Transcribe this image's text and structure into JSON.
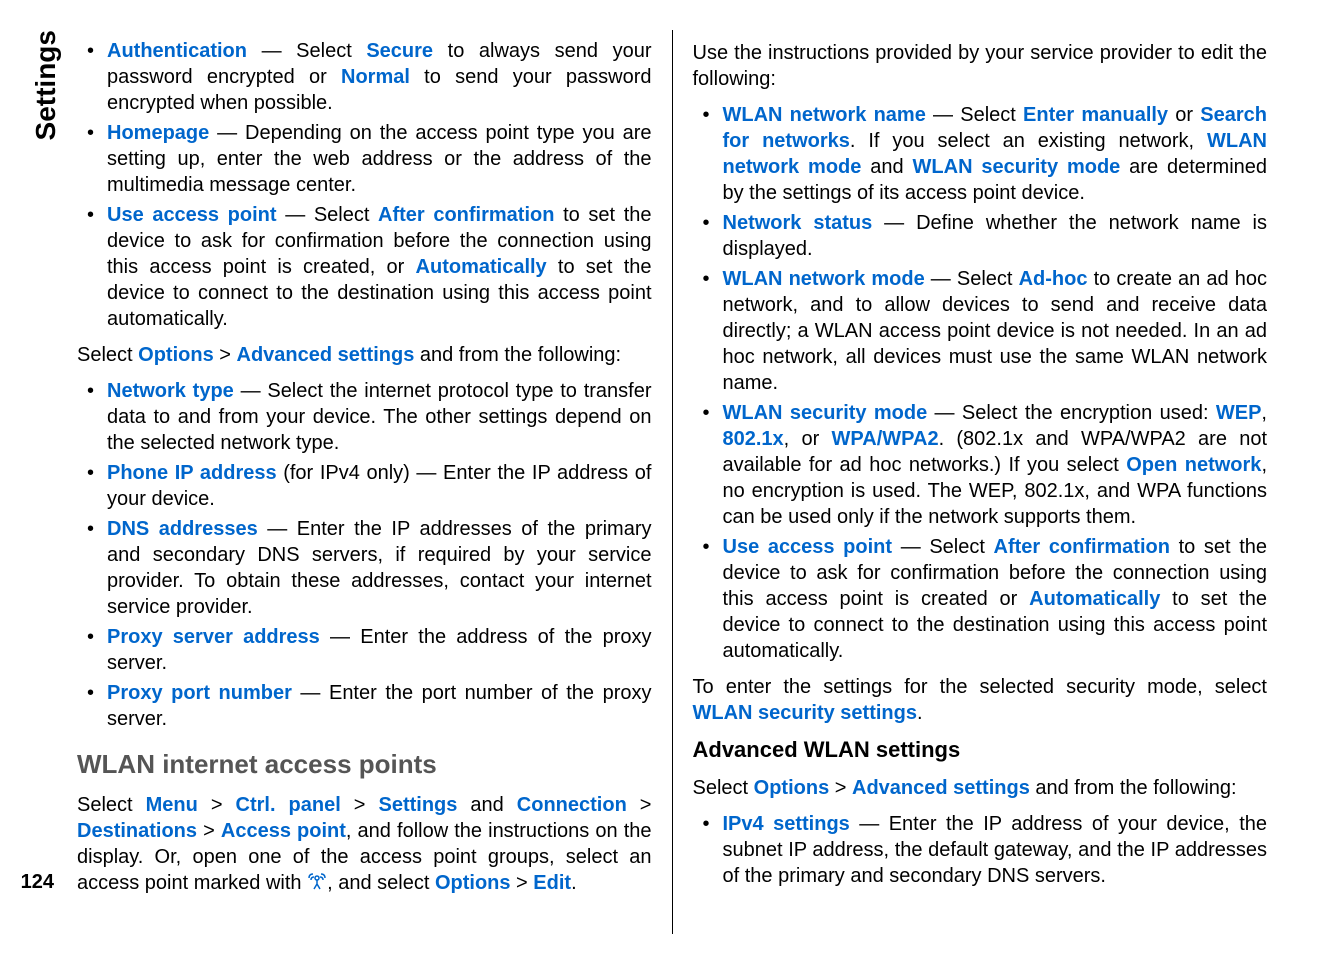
{
  "sidebar": {
    "label": "Settings"
  },
  "page_number": "124",
  "left": {
    "bullets1": [
      {
        "term": "Authentication",
        "pre": " — Select ",
        "opt1": "Secure",
        "mid1": " to always send your password encrypted or ",
        "opt2": "Normal",
        "tail": " to send your password encrypted when possible."
      },
      {
        "term": "Homepage",
        "tail": " — Depending on the access point type you are setting up, enter the web address or the address of the multimedia message center."
      },
      {
        "term": "Use access point",
        "pre": " — Select ",
        "opt1": "After confirmation",
        "mid1": " to set the device to ask for confirmation before the connection using this access point is created, or ",
        "opt2": "Automatically",
        "tail": " to set the device to connect to the destination using this access point automatically."
      }
    ],
    "para1": {
      "pre": "Select ",
      "opt1": "Options",
      "gt1": " > ",
      "opt2": "Advanced settings",
      "tail": " and from the following:"
    },
    "bullets2": [
      {
        "term": "Network type",
        "tail": " — Select the internet protocol type to transfer data to and from your device. The other settings depend on the selected network type."
      },
      {
        "term": "Phone IP address",
        "extra": " (for IPv4 only) — Enter the IP address of your device."
      },
      {
        "term": "DNS addresses",
        "tail": " — Enter the IP addresses of the primary and secondary DNS servers, if required by your service provider. To obtain these addresses, contact your internet service provider."
      },
      {
        "term": "Proxy server address",
        "tail": " — Enter the address of the proxy server."
      },
      {
        "term": "Proxy port number",
        "tail": " — Enter the port number of the proxy server."
      }
    ],
    "h2": "WLAN internet access points",
    "para2": {
      "pre": "Select ",
      "m1": "Menu",
      "gt1": " > ",
      "m2": "Ctrl. panel",
      "gt2": " > ",
      "m3": "Settings",
      "and1": " and ",
      "m4": "Connection",
      "gt3": " > ",
      "m5": "Destinations",
      "gt4": " > ",
      "m6": "Access point",
      "mid": ", and follow the instructions on the display. Or, open one of the access point groups, select an access point marked with ",
      "tail": ", and select ",
      "m7": "Options",
      "gt5": " > ",
      "m8": "Edit",
      "dot": "."
    }
  },
  "right": {
    "para1": "Use the instructions provided by your service provider to edit the following:",
    "bullets1": [
      {
        "term": "WLAN network name",
        "pre": " — Select ",
        "o1": "Enter manually",
        "or": " or ",
        "o2": "Search for networks",
        "mid": ". If you select an existing network, ",
        "o3": "WLAN network mode",
        "and": " and ",
        "o4": "WLAN security mode",
        "tail": " are determined by the settings of its access point device."
      },
      {
        "term": "Network status",
        "tail": " — Define whether the network name is displayed."
      },
      {
        "term": "WLAN network mode",
        "pre": " — Select ",
        "o1": "Ad-hoc",
        "tail": " to create an ad hoc network, and to allow devices to send and receive data directly; a WLAN access point device is not needed. In an ad hoc network, all devices must use the same WLAN network name."
      },
      {
        "term": "WLAN security mode",
        "pre": " — Select the encryption used: ",
        "o1": "WEP",
        "c1": ", ",
        "o2": "802.1x",
        "c2": ", or ",
        "o3": "WPA/WPA2",
        "mid": ". (802.1x and WPA/WPA2 are not available for ad hoc networks.) If you select ",
        "o4": "Open network",
        "tail": ", no encryption is used. The WEP, 802.1x, and WPA functions can be used only if the network supports them."
      },
      {
        "term": "Use access point",
        "pre": " — Select ",
        "o1": "After confirmation",
        "mid": " to set the device to ask for confirmation before the connection using this access point is created or ",
        "o2": "Automatically",
        "tail": " to set the device to connect to the destination using this access point automatically."
      }
    ],
    "para2": {
      "pre": "To enter the settings for the selected security mode, select ",
      "o1": "WLAN security settings",
      "dot": "."
    },
    "h3": "Advanced WLAN settings",
    "para3": {
      "pre": "Select ",
      "o1": "Options",
      "gt": " > ",
      "o2": "Advanced settings",
      "tail": " and from the following:"
    },
    "bullets2": [
      {
        "term": "IPv4 settings",
        "tail": " — Enter the IP address of your device, the subnet IP address, the default gateway, and the IP addresses of the primary and secondary DNS servers."
      }
    ]
  }
}
